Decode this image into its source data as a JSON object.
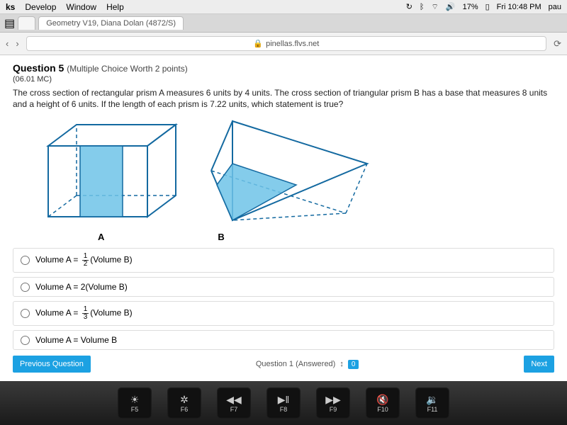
{
  "menubar": {
    "items": [
      "ks",
      "Develop",
      "Window",
      "Help"
    ],
    "status": {
      "battery": "17%",
      "time": "Fri 10:48 PM",
      "user": "pau"
    }
  },
  "tabs": {
    "active": "Geometry V19, Diana Dolan (4872/S)"
  },
  "toolbar": {
    "url": "pinellas.flvs.net",
    "lock": "🔒"
  },
  "question": {
    "title": "Question 5",
    "subtitle": "(Multiple Choice Worth 2 points)",
    "code": "(06.01 MC)",
    "prompt": "The cross section of rectangular prism A measures 6 units by 4 units. The cross section of triangular prism B has a base that measures 8 units and a height of 6 units. If the length of each prism is 7.22 units, which statement is true?",
    "labelA": "A",
    "labelB": "B"
  },
  "options": {
    "o1_pre": "Volume A = ",
    "o1_num": "1",
    "o1_den": "2",
    "o1_post": "(Volume B)",
    "o2": "Volume A = 2(Volume B)",
    "o3_pre": "Volume A = ",
    "o3_num": "1",
    "o3_den": "3",
    "o3_post": "(Volume B)",
    "o4": "Volume A = Volume B"
  },
  "nav": {
    "prev": "Previous Question",
    "next": "Next",
    "status_label": "Question 1 (Answered)",
    "status_num": "0"
  },
  "keys": {
    "f5": "F5",
    "f6": "F6",
    "f7": "F7",
    "f8": "F8",
    "f9": "F9",
    "f10": "F10",
    "f11": "F11",
    "g5": "☀",
    "g6": "✲",
    "g7": "◀◀",
    "g8": "▶‖",
    "g9": "▶▶",
    "g10": "🔇",
    "g11": "🔉"
  }
}
